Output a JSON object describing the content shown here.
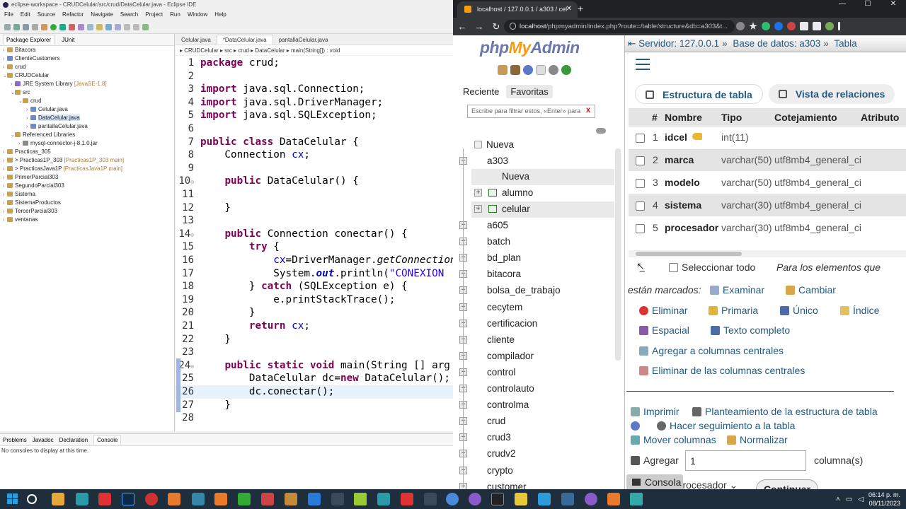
{
  "eclipse": {
    "title": "eclipse-workspace - CRUDCelular/src/crud/DataCelular.java - Eclipse IDE",
    "menu": [
      "File",
      "Edit",
      "Source",
      "Refactor",
      "Navigate",
      "Search",
      "Project",
      "Run",
      "Window",
      "Help"
    ],
    "pkg_tabs": [
      "Package Explorer",
      "JUnit"
    ],
    "tree": [
      {
        "label": "Bitacora",
        "indent": 0,
        "tw": ">"
      },
      {
        "label": "ClienteCustomers",
        "indent": 0,
        "tw": ">"
      },
      {
        "label": "crud",
        "indent": 0,
        "tw": ">"
      },
      {
        "label": "CRUDCelular",
        "indent": 0,
        "tw": "v"
      },
      {
        "label": "JRE System Library",
        "extra": "[JavaSE-1.8]",
        "indent": 1,
        "tw": ">"
      },
      {
        "label": "src",
        "indent": 1,
        "tw": "v"
      },
      {
        "label": "crud",
        "indent": 2,
        "tw": "v"
      },
      {
        "label": "Celular.java",
        "indent": 3,
        "tw": ">"
      },
      {
        "label": "DataCelular.java",
        "indent": 3,
        "tw": ">",
        "sel": true
      },
      {
        "label": "pantallaCelular.java",
        "indent": 3,
        "tw": ">"
      },
      {
        "label": "Referenced Libraries",
        "indent": 1,
        "tw": "v"
      },
      {
        "label": "mysql-connector-j-8.1.0.jar",
        "indent": 2,
        "tw": ">"
      },
      {
        "label": "Practicas_305",
        "indent": 0,
        "tw": ">"
      },
      {
        "label": "> Practicas1P_303",
        "extra": "[Practicas1P_303 main]",
        "indent": 0,
        "tw": ">"
      },
      {
        "label": "> PracticasJava1P",
        "extra": "[PracticasJava1P main]",
        "indent": 0,
        "tw": ">"
      },
      {
        "label": "PrimerParcial303",
        "indent": 0,
        "tw": ">"
      },
      {
        "label": "SegundoParcial303",
        "indent": 0,
        "tw": ">"
      },
      {
        "label": "Sistema",
        "indent": 0,
        "tw": ">"
      },
      {
        "label": "SistemaProductos",
        "indent": 0,
        "tw": ">"
      },
      {
        "label": "TercerParcial303",
        "indent": 0,
        "tw": ">"
      },
      {
        "label": "ventanas",
        "indent": 0,
        "tw": ">"
      }
    ],
    "editor_tabs": [
      "Celular.java",
      "*DataCelular.java",
      "pantallaCelular.java"
    ],
    "breadcrumb": "▸ CRUDCelular ▸ src ▸ crud ▸ DataCelular ▸ main(String[]) : void",
    "console_tabs": [
      "Problems",
      "Javadoc",
      "Declaration",
      "Console"
    ],
    "console_msg": "No consoles to display at this time."
  },
  "browser": {
    "tab_title": "localhost / 127.0.0.1 / a303 / cel",
    "url_host": "localhost",
    "url_path": "/phpmyadmin/index.php?route=/table/structure&db=a303&t...",
    "logo_php": "php",
    "logo_my": "My",
    "logo_admin": "Admin",
    "nav_tabs": [
      "Reciente",
      "Favoritas"
    ],
    "filter_placeholder": "Escribe para filtrar estos, «Enter» para",
    "filter_clear": "X",
    "nueva_root": "Nueva",
    "db_open": "a303",
    "db_children": [
      "Nueva",
      "alumno",
      "celular"
    ],
    "databases": [
      "a605",
      "batch",
      "bd_plan",
      "bitacora",
      "bolsa_de_trabajo",
      "cecytem",
      "certificacion",
      "cliente",
      "compilador",
      "control",
      "controlauto",
      "controlma",
      "crud",
      "crud3",
      "crudv2",
      "crypto",
      "customer"
    ],
    "crumb_server": "Servidor: 127.0.0.1",
    "crumb_db": "Base de datos: a303",
    "crumb_table": "Tabla",
    "subtab_structure": "Estructura de tabla",
    "subtab_relations": "Vista de relaciones",
    "columns": [
      "#",
      "Nombre",
      "Tipo",
      "Cotejamiento",
      "Atributo"
    ],
    "rows": [
      {
        "n": "1",
        "name": "idcel",
        "type": "int(11)",
        "coll": "",
        "key": true
      },
      {
        "n": "2",
        "name": "marca",
        "type": "varchar(50)",
        "coll": "utf8mb4_general_ci"
      },
      {
        "n": "3",
        "name": "modelo",
        "type": "varchar(50)",
        "coll": "utf8mb4_general_ci"
      },
      {
        "n": "4",
        "name": "sistema",
        "type": "varchar(30)",
        "coll": "utf8mb4_general_ci"
      },
      {
        "n": "5",
        "name": "procesador",
        "type": "varchar(30)",
        "coll": "utf8mb4_general_ci"
      }
    ],
    "select_all": "Seleccionar todo",
    "for_marked": "Para los elementos que",
    "are_marked": "están marcados:",
    "actions": {
      "examinar": "Examinar",
      "cambiar": "Cambiar",
      "eliminar": "Eliminar",
      "primaria": "Primaria",
      "unico": "Único",
      "indice": "Índice",
      "espacial": "Espacial",
      "texto": "Texto completo",
      "agregar_central": "Agregar a columnas centrales",
      "eliminar_central": "Eliminar de las columnas centrales"
    },
    "imprimir": "Imprimir",
    "planteamiento": "Planteamiento de la estructura de tabla",
    "seguimiento": "Hacer seguimiento a la tabla",
    "mover": "Mover columnas",
    "normalizar": "Normalizar",
    "agregar": "Agregar",
    "agregar_val": "1",
    "columnas": "columna(s)",
    "posicion": "e procesador",
    "continuar": "Continuar",
    "consola": "Consola"
  },
  "taskbar": {
    "time": "06:14 p. m.",
    "date": "08/11/2023"
  }
}
